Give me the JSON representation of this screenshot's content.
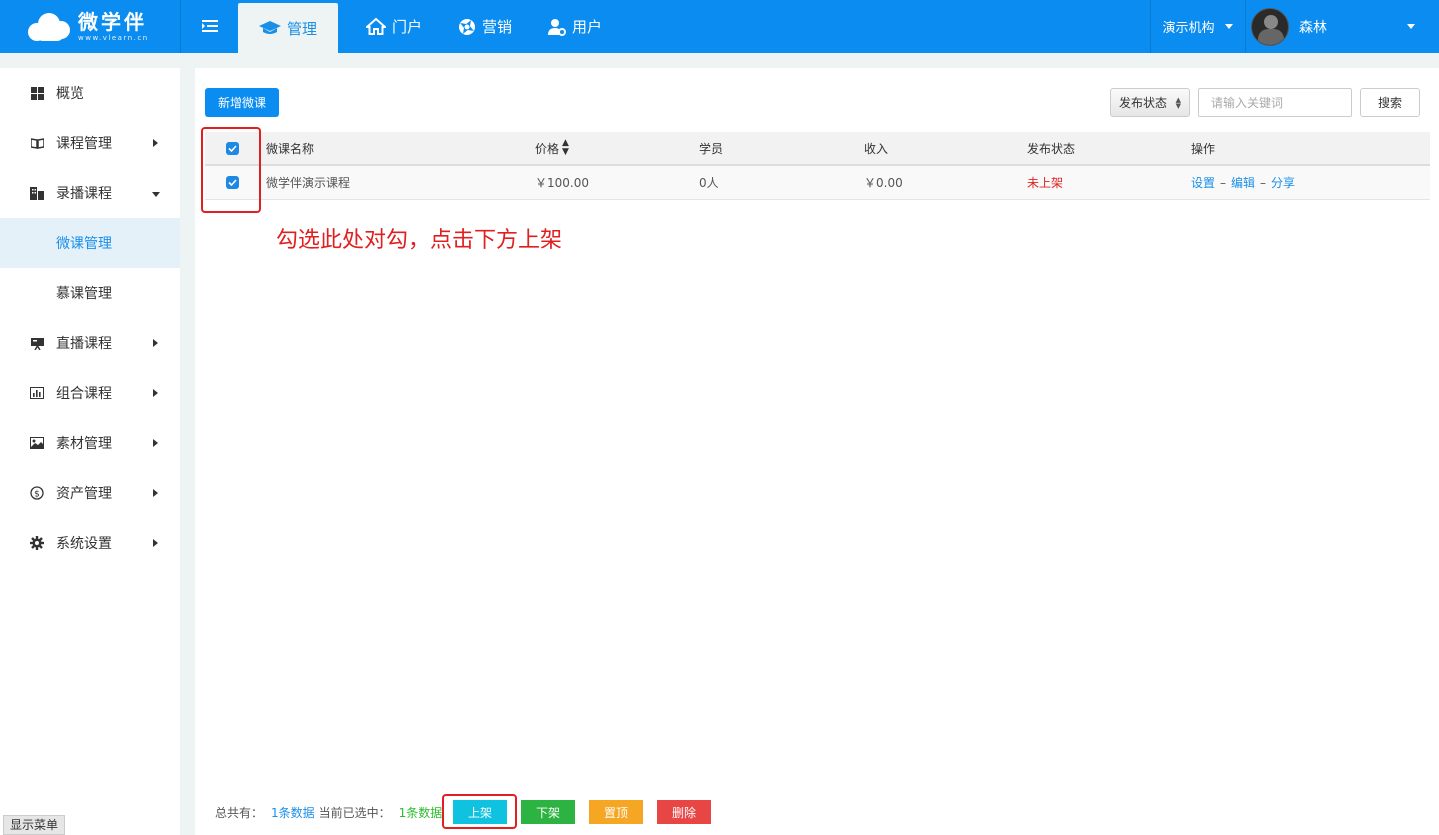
{
  "header": {
    "logo_cn": "微学伴",
    "logo_en": "www.vlearn.cn",
    "nav": [
      {
        "label": "管理",
        "icon": "graduation-cap-icon",
        "active": true
      },
      {
        "label": "门户",
        "icon": "home-icon",
        "active": false
      },
      {
        "label": "营销",
        "icon": "aperture-icon",
        "active": false
      },
      {
        "label": "用户",
        "icon": "user-gear-icon",
        "active": false
      }
    ],
    "org": "演示机构",
    "username": "森林"
  },
  "sidebar": {
    "items": [
      {
        "label": "概览",
        "icon": "grid-icon"
      },
      {
        "label": "课程管理",
        "icon": "book-icon"
      },
      {
        "label": "录播课程",
        "icon": "building-icon"
      },
      {
        "label": "直播课程",
        "icon": "presentation-icon"
      },
      {
        "label": "组合课程",
        "icon": "bar-chart-icon"
      },
      {
        "label": "素材管理",
        "icon": "image-icon"
      },
      {
        "label": "资产管理",
        "icon": "dollar-circle-icon"
      },
      {
        "label": "系统设置",
        "icon": "gear-icon"
      }
    ],
    "sub_items": [
      "微课管理",
      "慕课管理"
    ],
    "show_menu": "显示菜单"
  },
  "toolbar": {
    "add_label": "新增微课",
    "status_select": "发布状态",
    "search_placeholder": "请输入关键词",
    "search_label": "搜索"
  },
  "table": {
    "headers": [
      "微课名称",
      "价格",
      "学员",
      "收入",
      "发布状态",
      "操作"
    ],
    "rows": [
      {
        "name": "微学伴演示课程",
        "price": "￥100.00",
        "students": "0人",
        "income": "￥0.00",
        "status": "未上架",
        "actions": [
          "设置",
          "编辑",
          "分享"
        ]
      }
    ]
  },
  "annotation": "勾选此处对勾，点击下方上架",
  "footer": {
    "total_label": "总共有：",
    "total_value": "1条数据",
    "selected_label": "当前已选中：",
    "selected_value": "1条数据",
    "buttons": [
      {
        "label": "上架",
        "color": "#0fc3e0"
      },
      {
        "label": "下架",
        "color": "#2db342"
      },
      {
        "label": "置顶",
        "color": "#f5a623"
      },
      {
        "label": "删除",
        "color": "#e84545"
      }
    ]
  }
}
